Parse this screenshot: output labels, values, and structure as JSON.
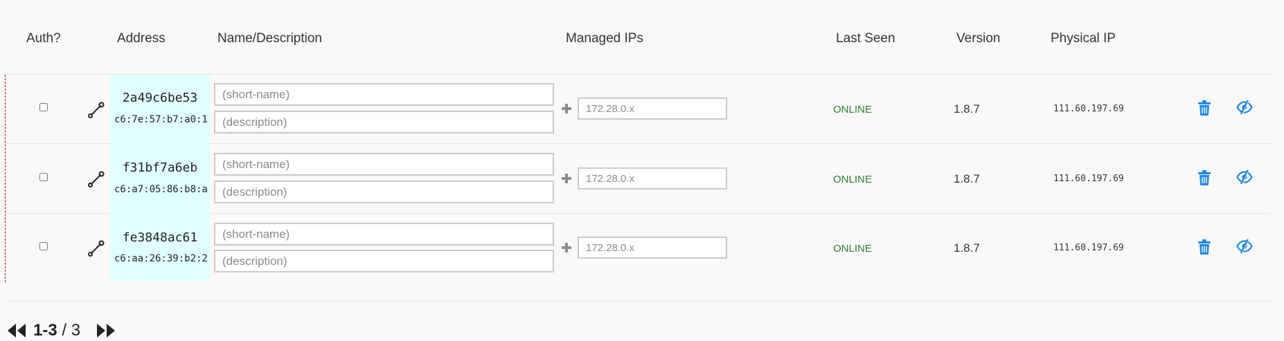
{
  "header": {
    "auth": "Auth?",
    "address": "Address",
    "name_description": "Name/Description",
    "managed_ips": "Managed IPs",
    "last_seen": "Last Seen",
    "version": "Version",
    "physical_ip": "Physical IP"
  },
  "placeholders": {
    "short_name": "(short-name)",
    "description": "(description)",
    "ip": "172.28.0.x"
  },
  "members": [
    {
      "authorized": false,
      "node_id": "2a49c6be53",
      "mac": "c6:7e:57:b7:a0:1",
      "status": "ONLINE",
      "version": "1.8.7",
      "physical_ip": "111.60.197.69"
    },
    {
      "authorized": false,
      "node_id": "f31bf7a6eb",
      "mac": "c6:a7:05:86:b8:a",
      "status": "ONLINE",
      "version": "1.8.7",
      "physical_ip": "111.60.197.69"
    },
    {
      "authorized": false,
      "node_id": "fe3848ac61",
      "mac": "c6:aa:26:39:b2:2",
      "status": "ONLINE",
      "version": "1.8.7",
      "physical_ip": "111.60.197.69"
    }
  ],
  "pagination": {
    "range": "1-3",
    "separator": " / ",
    "total": "3"
  },
  "colors": {
    "accent": "#1e88e5",
    "address_highlight": "#e0ffff",
    "online": "#2e7d32",
    "unauthorized_marker": "#b00000"
  },
  "icons": {
    "wrench": "wrench-icon",
    "plus": "plus-icon",
    "trash": "trash-icon",
    "hide": "eye-slash-icon",
    "first": "double-chevron-left-icon",
    "last": "double-chevron-right-icon"
  }
}
